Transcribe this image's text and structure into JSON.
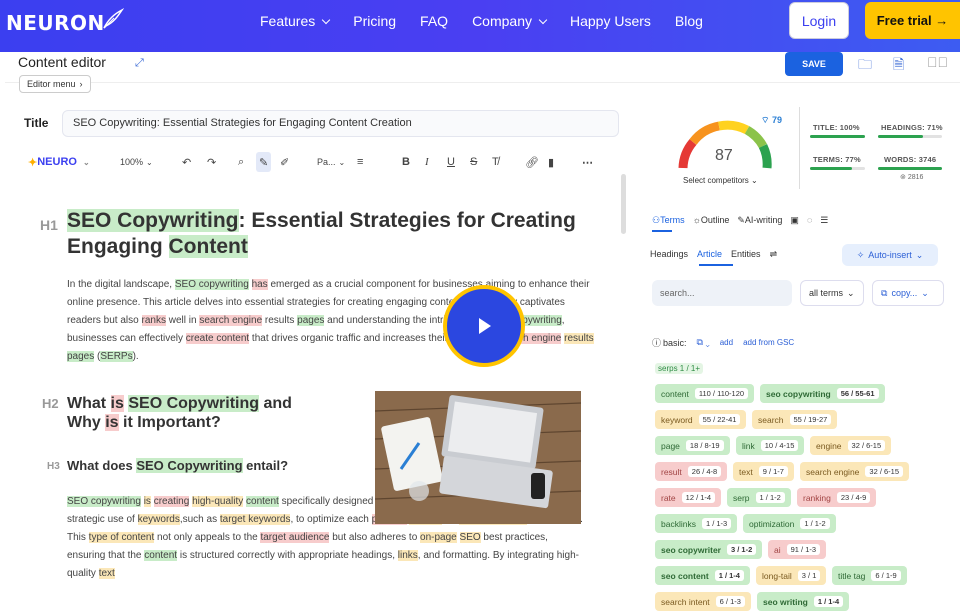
{
  "nav": {
    "logo": "NEURON",
    "links": [
      "Features",
      "Pricing",
      "FAQ",
      "Company",
      "Happy Users",
      "Blog"
    ],
    "login": "Login",
    "trial": "Free trial →"
  },
  "editor": {
    "header_title": "Content editor",
    "editor_menu": "Editor menu",
    "title_label": "Title",
    "title_value": "SEO Copywriting: Essential Strategies for Engaging Content Creation",
    "toolbar": {
      "brand": "NEURO",
      "zoom": "100%",
      "paragraph": "Pa..."
    }
  },
  "content": {
    "h1_tag": "H1",
    "h2_tag": "H2",
    "h3_tag": "H3",
    "h1": [
      [
        "SEO Copywriting",
        "g"
      ],
      [
        ": Essential Strategies for Creating Engaging ",
        ""
      ],
      [
        "Content",
        "g"
      ]
    ],
    "p1": [
      [
        "In the digital landscape, ",
        ""
      ],
      [
        "SEO copywriting",
        "g"
      ],
      [
        " ",
        ""
      ],
      [
        "has",
        "r"
      ],
      [
        " emerged as a crucial component for businesses aiming to enhance their online presence. This article delves into essential strategies for creating engaging contentthat not only captivates readers but also ",
        ""
      ],
      [
        "ranks",
        "r"
      ],
      [
        " well in ",
        ""
      ],
      [
        "search engine",
        "r"
      ],
      [
        " results ",
        ""
      ],
      [
        "pages",
        "g"
      ],
      [
        " and understanding the intricacies of ",
        ""
      ],
      [
        "SEO copywriting",
        "g"
      ],
      [
        ", businesses can effectively ",
        ""
      ],
      [
        "create content",
        "r"
      ],
      [
        " that drives organic traffic and increases their visibility in ",
        ""
      ],
      [
        "search engine",
        "r"
      ],
      [
        " ",
        ""
      ],
      [
        "results",
        "y"
      ],
      [
        " ",
        ""
      ],
      [
        "pages",
        "g"
      ],
      [
        " (",
        ""
      ],
      [
        "SERPs",
        "g"
      ],
      [
        ").",
        ""
      ]
    ],
    "h2": [
      [
        "What ",
        ""
      ],
      [
        "is",
        "r"
      ],
      [
        " ",
        ""
      ],
      [
        "SEO Copywriting",
        "g"
      ],
      [
        " and Why ",
        ""
      ],
      [
        "is",
        "r"
      ],
      [
        " it Important?",
        ""
      ]
    ],
    "h3": [
      [
        "What does ",
        ""
      ],
      [
        "SEO Copywriting",
        "g"
      ],
      [
        " entail?",
        ""
      ]
    ],
    "p2": [
      [
        "SEO copywriting",
        "g"
      ],
      [
        " ",
        ""
      ],
      [
        "is",
        "y"
      ],
      [
        " ",
        ""
      ],
      [
        "creating",
        "r"
      ],
      [
        " ",
        ""
      ],
      [
        "high-quality",
        "y"
      ],
      [
        " ",
        ""
      ],
      [
        "content",
        "g"
      ],
      [
        " specifically designed to ",
        ""
      ],
      [
        "rank",
        "r"
      ],
      [
        " well in ",
        ""
      ],
      [
        "search engines",
        "y"
      ],
      [
        ". It involves the strategic use of ",
        ""
      ],
      [
        "keywords",
        "y"
      ],
      [
        ",such as ",
        ""
      ],
      [
        "target keywords",
        "y"
      ],
      [
        ", to optimize each ",
        ""
      ],
      [
        "piece of",
        "r"
      ],
      [
        " ",
        ""
      ],
      [
        "content",
        "y"
      ],
      [
        " for ",
        ""
      ],
      [
        "search engines",
        "y"
      ],
      [
        " like Google. This ",
        ""
      ],
      [
        "type of content",
        "y"
      ],
      [
        " not only appeals to the ",
        ""
      ],
      [
        "target audience",
        "r"
      ],
      [
        " but also adheres to ",
        ""
      ],
      [
        "on-page",
        "y"
      ],
      [
        " ",
        ""
      ],
      [
        "SEO",
        "y"
      ],
      [
        " best practices, ensuring that the ",
        ""
      ],
      [
        "content",
        "g"
      ],
      [
        " is structured correctly with appropriate headings, ",
        ""
      ],
      [
        "links",
        "y"
      ],
      [
        ", and formatting. By integrating high-quality ",
        ""
      ],
      [
        "text",
        "y"
      ]
    ]
  },
  "right": {
    "save": "SAVE",
    "score": "87",
    "score_badge": "79",
    "select_competitors": "Select competitors",
    "stats": [
      {
        "label": "TITLE: 100%",
        "pct": 100
      },
      {
        "label": "HEADINGS: 71%",
        "pct": 71
      },
      {
        "label": "TERMS: 77%",
        "pct": 77
      },
      {
        "label": "WORDS: 3746",
        "pct": 100
      }
    ],
    "words_sub": "2816",
    "tabs": [
      "Terms",
      "Outline",
      "AI-writing"
    ],
    "subtabs": [
      "Headings",
      "Article",
      "Entities"
    ],
    "auto_insert": "Auto-insert",
    "search_placeholder": "search...",
    "all_terms": "all terms",
    "copy": "copy...",
    "basic_label": "basic:",
    "add": "add",
    "add_gsc": "add from GSC",
    "serps": "serps  1 / 1+",
    "chips": [
      {
        "t": "content",
        "c": "110 / 110-120",
        "k": "g",
        "b": false
      },
      {
        "t": "seo copywriting",
        "c": "56 / 55-61",
        "k": "g",
        "b": true
      },
      {
        "t": "keyword",
        "c": "55 / 22-41",
        "k": "y",
        "b": false
      },
      {
        "t": "search",
        "c": "55 / 19-27",
        "k": "y",
        "b": false
      },
      {
        "t": "page",
        "c": "18 / 8-19",
        "k": "g",
        "b": false
      },
      {
        "t": "link",
        "c": "10 / 4-15",
        "k": "g",
        "b": false
      },
      {
        "t": "engine",
        "c": "32 / 6-15",
        "k": "y",
        "b": false
      },
      {
        "t": "result",
        "c": "26 / 4-8",
        "k": "r",
        "b": false
      },
      {
        "t": "text",
        "c": "9 / 1-7",
        "k": "y",
        "b": false
      },
      {
        "t": "search engine",
        "c": "32 / 6-15",
        "k": "y",
        "b": false
      },
      {
        "t": "rate",
        "c": "12 / 1-4",
        "k": "r",
        "b": false
      },
      {
        "t": "serp",
        "c": "1 / 1-2",
        "k": "g",
        "b": false
      },
      {
        "t": "ranking",
        "c": "23 / 4-9",
        "k": "r",
        "b": false
      },
      {
        "t": "backlinks",
        "c": "1 / 1-3",
        "k": "g",
        "b": false
      },
      {
        "t": "optimization",
        "c": "1 / 1-2",
        "k": "g",
        "b": false
      },
      {
        "t": "seo copywriter",
        "c": "3 / 1-2",
        "k": "g",
        "b": true
      },
      {
        "t": "ai",
        "c": "91 / 1-3",
        "k": "r",
        "b": false
      },
      {
        "t": "seo content",
        "c": "1 / 1-4",
        "k": "g",
        "b": true
      },
      {
        "t": "long-tail",
        "c": "3 / 1",
        "k": "y",
        "b": false
      },
      {
        "t": "title tag",
        "c": "6 / 1-9",
        "k": "g",
        "b": false
      },
      {
        "t": "search intent",
        "c": "6 / 1-3",
        "k": "y",
        "b": false
      },
      {
        "t": "seo writing",
        "c": "1 / 1-4",
        "k": "g",
        "b": true
      }
    ]
  }
}
